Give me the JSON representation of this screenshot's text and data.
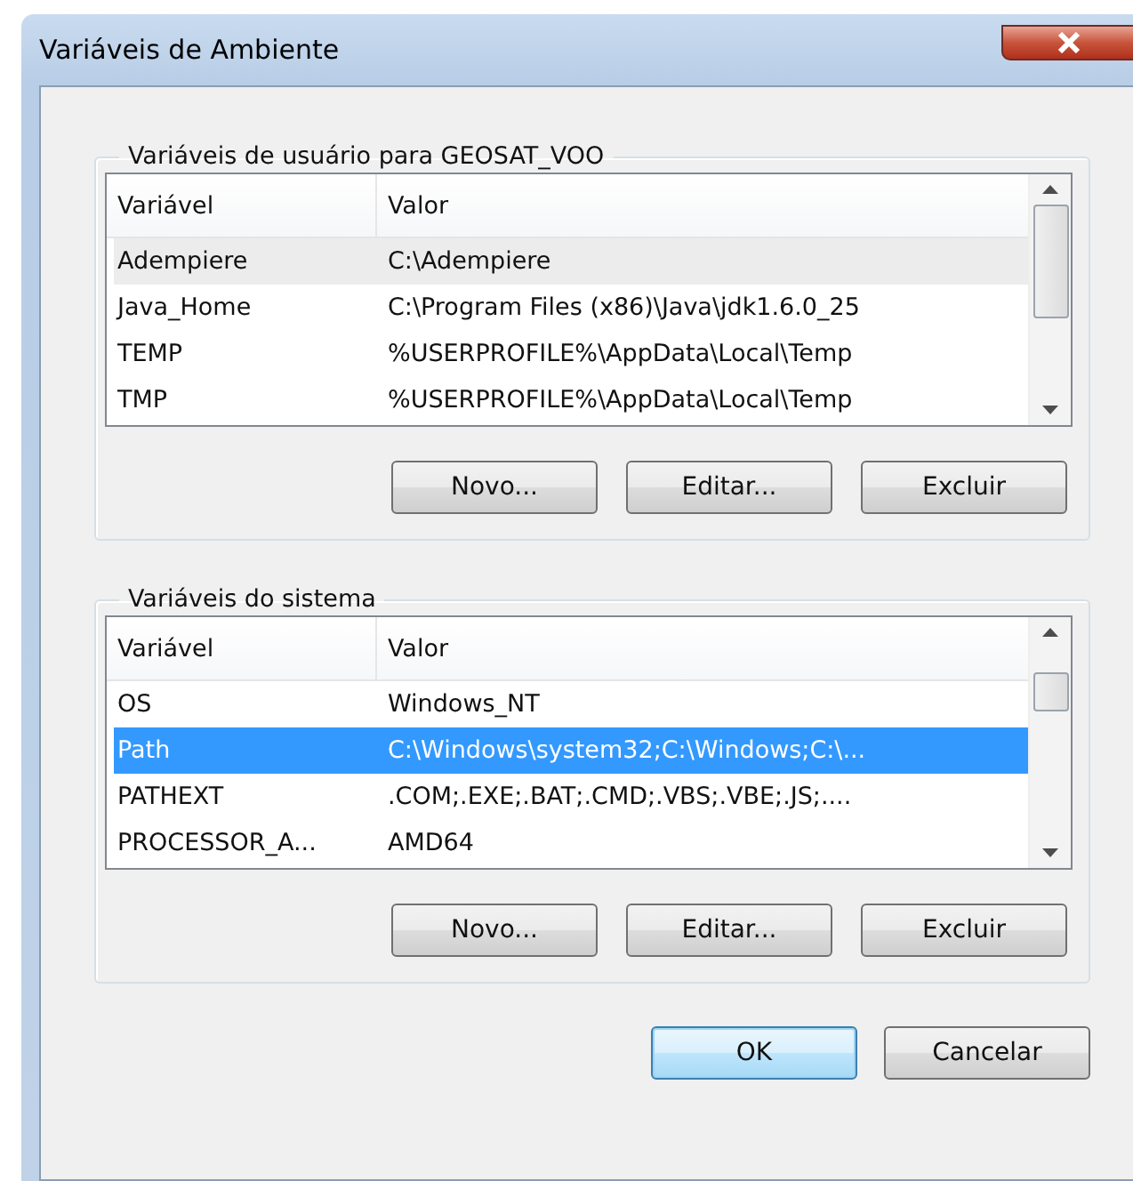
{
  "window": {
    "title": "Variáveis de Ambiente"
  },
  "groups": [
    {
      "title": "Variáveis de usuário para GEOSAT_VOO",
      "focused": false,
      "columns": [
        "Variável",
        "Valor"
      ],
      "rows": [
        {
          "variable": "Adempiere",
          "value": "C:\\Adempiere",
          "selected": true
        },
        {
          "variable": "Java_Home",
          "value": "C:\\Program Files (x86)\\Java\\jdk1.6.0_25",
          "selected": false
        },
        {
          "variable": "TEMP",
          "value": "%USERPROFILE%\\AppData\\Local\\Temp",
          "selected": false
        },
        {
          "variable": "TMP",
          "value": "%USERPROFILE%\\AppData\\Local\\Temp",
          "selected": false
        }
      ],
      "buttons": [
        "Novo...",
        "Editar...",
        "Excluir"
      ]
    },
    {
      "title": "Variáveis do sistema",
      "focused": true,
      "columns": [
        "Variável",
        "Valor"
      ],
      "rows": [
        {
          "variable": "OS",
          "value": "Windows_NT",
          "selected": false
        },
        {
          "variable": "Path",
          "value": "C:\\Windows\\system32;C:\\Windows;C:\\...",
          "selected": true
        },
        {
          "variable": "PATHEXT",
          "value": ".COM;.EXE;.BAT;.CMD;.VBS;.VBE;.JS;....",
          "selected": false
        },
        {
          "variable": "PROCESSOR_A...",
          "value": "AMD64",
          "selected": false
        }
      ],
      "buttons": [
        "Novo...",
        "Editar...",
        "Excluir"
      ]
    }
  ],
  "footer_buttons": [
    {
      "label": "OK",
      "default": true
    },
    {
      "label": "Cancelar",
      "default": false
    }
  ]
}
